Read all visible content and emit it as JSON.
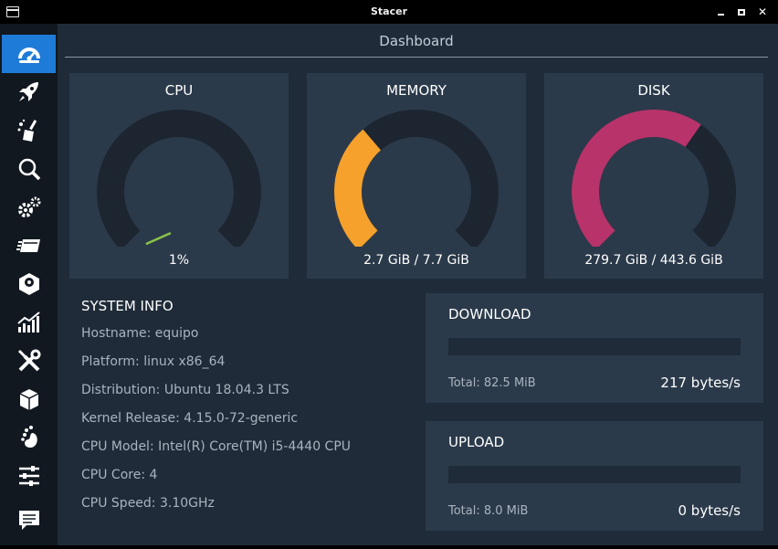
{
  "window": {
    "title": "Stacer"
  },
  "sidebar": {
    "items": [
      {
        "name": "dashboard",
        "icon": "speedometer-icon",
        "active": true
      },
      {
        "name": "startup-apps",
        "icon": "rocket-icon",
        "active": false
      },
      {
        "name": "system-cleaner",
        "icon": "broom-icon",
        "active": false
      },
      {
        "name": "search",
        "icon": "magnifier-icon",
        "active": false
      },
      {
        "name": "services",
        "icon": "gears-icon",
        "active": false
      },
      {
        "name": "processes",
        "icon": "stack-icon",
        "active": false
      },
      {
        "name": "uninstaller",
        "icon": "disk-icon",
        "active": false
      },
      {
        "name": "resources",
        "icon": "bar-chart-icon",
        "active": false
      },
      {
        "name": "helpers",
        "icon": "tools-icon",
        "active": false
      },
      {
        "name": "apt-repository",
        "icon": "package-icon",
        "active": false
      },
      {
        "name": "gnome-settings",
        "icon": "gnome-foot-icon",
        "active": false
      },
      {
        "name": "settings",
        "icon": "sliders-icon",
        "active": false
      },
      {
        "name": "feedback",
        "icon": "chat-icon",
        "active": false
      }
    ]
  },
  "dashboard": {
    "title": "Dashboard",
    "gauges": [
      {
        "label": "CPU",
        "value_text": "1%",
        "fraction": 0.01,
        "color": "#8bc34a"
      },
      {
        "label": "MEMORY",
        "value_text": "2.7 GiB / 7.7 GiB",
        "fraction": 0.35,
        "color": "#f5a12c"
      },
      {
        "label": "DISK",
        "value_text": "279.7 GiB / 443.6 GiB",
        "fraction": 0.63,
        "color": "#b8336a"
      }
    ],
    "system_info": {
      "title": "SYSTEM INFO",
      "rows": [
        "Hostname: equipo",
        "Platform: linux x86_64",
        "Distribution: Ubuntu 18.04.3 LTS",
        "Kernel Release: 4.15.0-72-generic",
        "CPU Model: Intel(R) Core(TM) i5-4440 CPU",
        "CPU Core: 4",
        "CPU Speed: 3.10GHz"
      ]
    },
    "download": {
      "title": "DOWNLOAD",
      "total": "Total: 82.5 MiB",
      "rate": "217 bytes/s",
      "level": 0
    },
    "upload": {
      "title": "UPLOAD",
      "total": "Total: 8.0 MiB",
      "rate": "0 bytes/s",
      "level": 0
    }
  },
  "colors": {
    "accent": "#1f7bd8",
    "card": "#2b3a4a",
    "background": "#1f2b38",
    "track": "#1c2530"
  }
}
